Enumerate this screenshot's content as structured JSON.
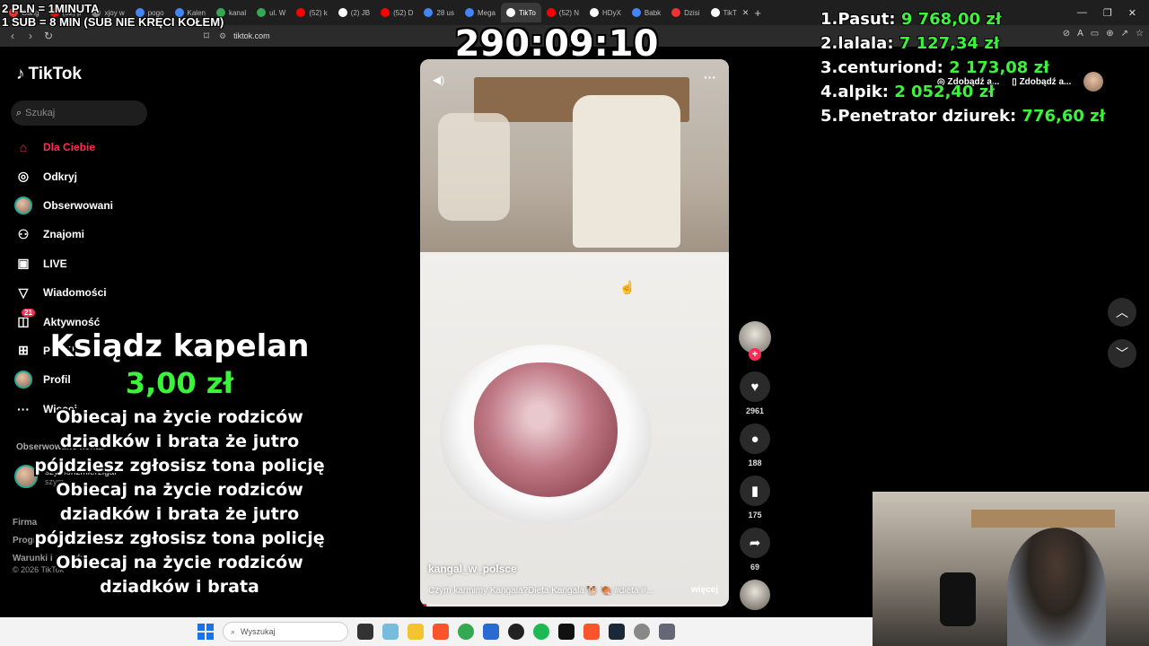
{
  "browser": {
    "tabs": [
      {
        "label": "Gang",
        "color": "#e33"
      },
      {
        "label": "(52) p",
        "color": "#f00"
      },
      {
        "label": "xjoy w",
        "color": "#888"
      },
      {
        "label": "pogo",
        "color": "#4285f4"
      },
      {
        "label": "Kalen",
        "color": "#4285f4"
      },
      {
        "label": "kanal",
        "color": "#34a853"
      },
      {
        "label": "ul. W",
        "color": "#34a853"
      },
      {
        "label": "(52) k",
        "color": "#f00"
      },
      {
        "label": "(2) JB",
        "color": "#fff"
      },
      {
        "label": "(52) D",
        "color": "#f00"
      },
      {
        "label": "28 us",
        "color": "#4285f4"
      },
      {
        "label": "Mega",
        "color": "#4285f4"
      },
      {
        "label": "TikTo",
        "color": "#fff"
      },
      {
        "label": "(52) N",
        "color": "#f00"
      },
      {
        "label": "HDyX",
        "color": "#fff"
      },
      {
        "label": "Babk",
        "color": "#4285f4"
      },
      {
        "label": "Dzisi",
        "color": "#e33"
      },
      {
        "label": "TikT",
        "color": "#fff"
      }
    ],
    "active_tab_close": "✕",
    "new_tab": "+",
    "url": "tiktok.com"
  },
  "overlay": {
    "line1": "2 PLN = 1MINUTA",
    "line2": "1 SUB = 8 MIN (SUB NIE KRĘCI KOŁEM)",
    "timer": "290:09:10"
  },
  "leaderboard": [
    {
      "rank": "1.",
      "name": "Pasut:",
      "amount": "9 768,00 zł"
    },
    {
      "rank": "2.",
      "name": "lalala:",
      "amount": "7 127,34 zł"
    },
    {
      "rank": "3.",
      "name": "centuriond:",
      "amount": "2 173,08 zł"
    },
    {
      "rank": "4.",
      "name": "alpik:",
      "amount": "2 052,40 zł"
    },
    {
      "rank": "5.",
      "name": "Penetrator dziurek:",
      "amount": "776,60 zł"
    }
  ],
  "tiktok": {
    "logo": "TikTok",
    "search_placeholder": "Szukaj",
    "nav": [
      {
        "label": "Dla Ciebie",
        "icon": "home-icon",
        "active": true
      },
      {
        "label": "Odkryj",
        "icon": "compass-icon"
      },
      {
        "label": "Obserwowani",
        "icon": "avatar-icon"
      },
      {
        "label": "Znajomi",
        "icon": "friends-icon"
      },
      {
        "label": "LIVE",
        "icon": "live-icon"
      },
      {
        "label": "Wiadomości",
        "icon": "message-icon"
      },
      {
        "label": "Aktywność",
        "icon": "activity-icon",
        "badge": "21"
      },
      {
        "label": "Prześlij",
        "icon": "upload-icon"
      },
      {
        "label": "Profil",
        "icon": "profile-icon"
      },
      {
        "label": "Więcej",
        "icon": "more-icon"
      }
    ],
    "followed_section": "Obserwowane konta",
    "followed_user": "szymonzmierzigar",
    "followed_user_sub": "szym",
    "footer_links": [
      "Firma",
      "Program",
      "Warunki i zasady"
    ],
    "copyright": "© 2026 TikTok",
    "topright": {
      "btn1": "Zdobądź a...",
      "btn2": "Zdobądź a..."
    }
  },
  "donation": {
    "name": "Ksiądz kapelan",
    "amount": "3,00 zł",
    "message": "Obiecaj na życie rodziców dziadków i brata że jutro pójdziesz zgłosisz tona policję Obiecaj na życie rodziców dziadków i brata że jutro pójdziesz zgłosisz tona policję Obiecaj na życie rodziców dziadków i brata"
  },
  "video": {
    "author": "kangal_w_polsce",
    "description": "Czym karmimy Kangala?Dieta Kangala 🐕 🍖 #dieta #...",
    "more": "więcej",
    "progress": 0.02,
    "likes": "2961",
    "comments": "188",
    "saves": "175",
    "shares": "69"
  },
  "taskbar": {
    "search_placeholder": "Wyszukaj"
  }
}
